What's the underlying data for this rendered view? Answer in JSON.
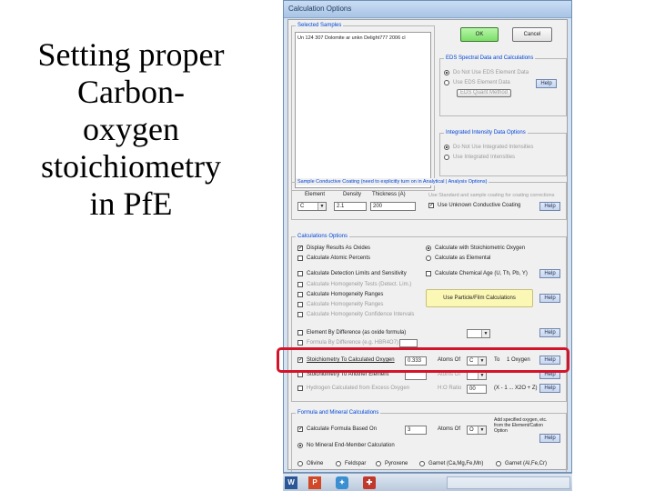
{
  "slide": {
    "title_lines": [
      "Setting proper",
      "Carbon-",
      "oxygen",
      "stoichiometry",
      "in PfE"
    ]
  },
  "window": {
    "title": "Calculation Options"
  },
  "buttons": {
    "ok": "OK",
    "cancel": "Cancel",
    "help": "Help"
  },
  "selected_samples": {
    "legend": "Selected Samples",
    "item": "Un 124 307 Dolomite ar unkn Delight777 2006 cl"
  },
  "eds": {
    "legend": "EDS Spectral Data and Calculations",
    "opt1": "Do Not Use EDS Element Data",
    "opt2": "Use EDS Element Data",
    "quant_button": "EDS Quant Method"
  },
  "integrated": {
    "legend": "Integrated Intensity Data Options",
    "opt1": "Do Not Use Integrated Intensities",
    "opt2": "Use Integrated Intensities"
  },
  "coating": {
    "legend": "Sample Conductive Coating (need to explicitly turn on in Analytical | Analysis Options)",
    "col_element": "Element",
    "col_density": "Density",
    "col_thickness": "Thickness (A)",
    "element": "C",
    "density": "2.1",
    "thickness": "200",
    "note": "Use Standard and sample coating for coating corrections",
    "use_label": "Use Unknown Conductive Coating"
  },
  "calc": {
    "legend": "Calculations Options",
    "display_oxides": "Display Results As Oxides",
    "atomic_percents": "Calculate Atomic Percents",
    "detection_limits": "Calculate Detection Limits and Sensitivity",
    "homogeneity_tests": "Calculate Homogeneity Tests (Detect. Lim.)",
    "homogeneity_ranges": "Calculate Homogeneity Ranges",
    "homogeneity_ranges2": "Calculate Homogeneity Ranges",
    "homogeneity_conf": "Calculate Homogeneity Confidence Intervals",
    "stoich_oxygen": "Calculate with Stoichiometric Oxygen",
    "as_elemental": "Calculate as Elemental",
    "chemical_age": "Calculate Chemical Age (U, Th, Pb, Y)",
    "particle_film": "Use Particle/Film Calculations",
    "element_by_diff": "Element By Difference (as oxide formula)",
    "formula_by_diff": "Formula By Difference (e.g. HBR4O7)",
    "stoich_to_oxygen": "Stoichiometry To Calculated Oxygen",
    "stoich_value": "0.333",
    "atoms_of": "Atoms Of",
    "stoich_element": "C",
    "to": "To",
    "oxygen": "1 Oxygen",
    "stoich_to_another": "Stoichiometry To Another Element",
    "hydrogen_label": "Hydrogen Calculated from Excess Oxygen",
    "h_ratio_label": "H:O Ratio",
    "h_ratio_value": "00",
    "h_formula": "(X - 1 ... X2O + Z)"
  },
  "formula": {
    "legend": "Formula and Mineral Calculations",
    "calc_formula": "Calculate Formula Based On",
    "formula_value": "3",
    "atoms_of": "Atoms Of",
    "formula_element": "O",
    "add_note": "Add specified oxygen, etc. from the Element/Cation Option",
    "no_endmember": "No Mineral End-Member Calculation",
    "olivine": "Olivine",
    "feldspar": "Feldspar",
    "pyroxene": "Pyroxene",
    "garnet1": "Garnet (Ca,Mg,Fe,Mn)",
    "garnet2": "Garnet (Al,Fe,Cr)"
  },
  "colors": {
    "highlight": "#d3142a",
    "legend_text": "#0046d5",
    "window_frame": "#6f8fb4"
  },
  "taskbar": {
    "icons": [
      "word-icon",
      "powerpoint-icon",
      "app-icon",
      "tool-icon"
    ]
  }
}
